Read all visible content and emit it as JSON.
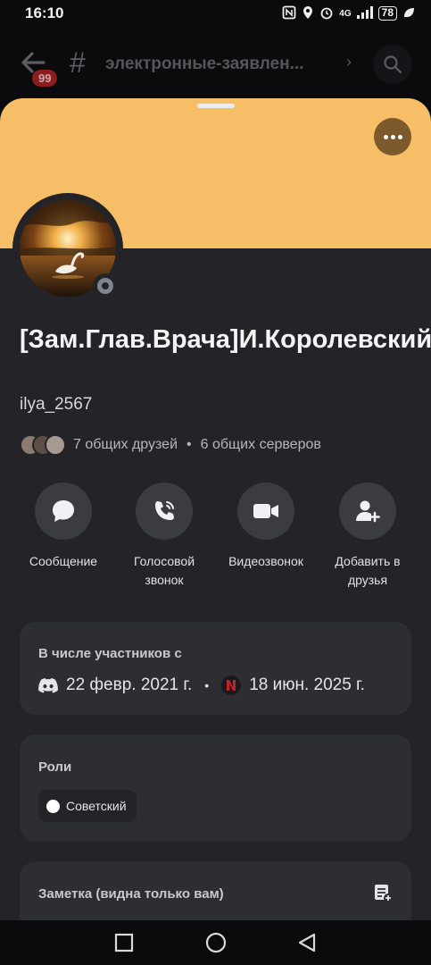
{
  "status_bar": {
    "time": "16:10",
    "network": "4G",
    "battery": "78"
  },
  "channel_header": {
    "unread_badge": "99",
    "channel_name": "электронные-заявлен..."
  },
  "profile": {
    "display_name": "[Зам.Глав.Врача]И.Королевский",
    "username": "ilya_2567",
    "mutual_friends": "7 общих друзей",
    "mutual_servers": "6 общих серверов",
    "separator": "•",
    "status": "offline",
    "banner_color": "#f6bf67"
  },
  "actions": [
    {
      "label": "Сообщение",
      "icon": "chat-bubble-icon"
    },
    {
      "label": "Голосовой звонок",
      "icon": "phone-icon"
    },
    {
      "label": "Видеозвонок",
      "icon": "video-camera-icon"
    },
    {
      "label": "Добавить в друзья",
      "icon": "add-friend-icon"
    }
  ],
  "member_since": {
    "title": "В числе участников с",
    "discord_date": "22 февр. 2021 г.",
    "server_date": "18 июн. 2025 г.",
    "separator": "•"
  },
  "roles": {
    "title": "Роли",
    "items": [
      {
        "name": "Советский",
        "color": "#ffffff"
      }
    ]
  },
  "note": {
    "title": "Заметка (видна только вам)"
  },
  "colors": {
    "sheet_bg": "#232328",
    "card_bg": "#2d2e34",
    "button_bg": "#3b3c42"
  }
}
